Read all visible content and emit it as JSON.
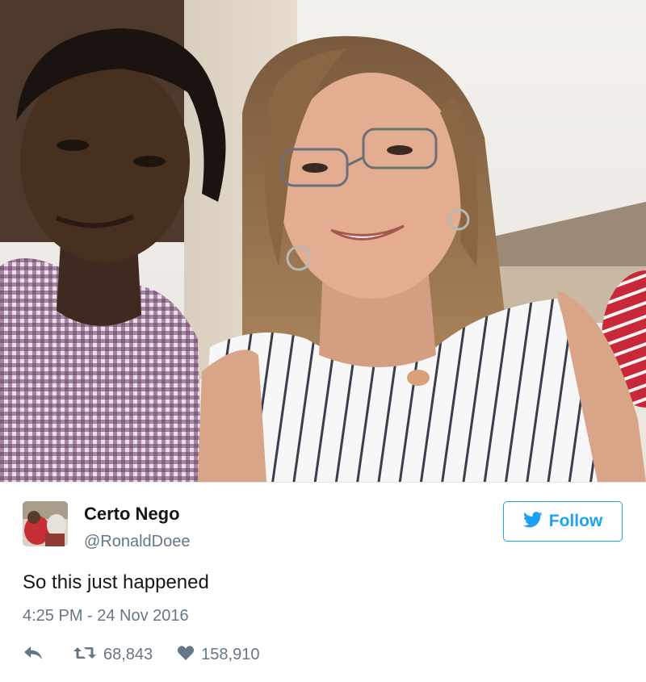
{
  "photo": {
    "description_icon": "selfie-photo-icon"
  },
  "tweet": {
    "display_name": "Certo Nego",
    "handle": "@RonaldDoee",
    "follow_label": "Follow",
    "text": "So this just happened",
    "timestamp": "4:25 PM - 24 Nov 2016",
    "retweet_count": "68,843",
    "like_count": "158,910"
  },
  "colors": {
    "accent": "#1da1f2",
    "secondary_text": "#657786",
    "primary_text": "#14171a",
    "divider": "#e1e8ed"
  },
  "icons": {
    "follow": "twitter-bird-icon",
    "reply": "reply-icon",
    "retweet": "retweet-icon",
    "like": "heart-icon"
  }
}
